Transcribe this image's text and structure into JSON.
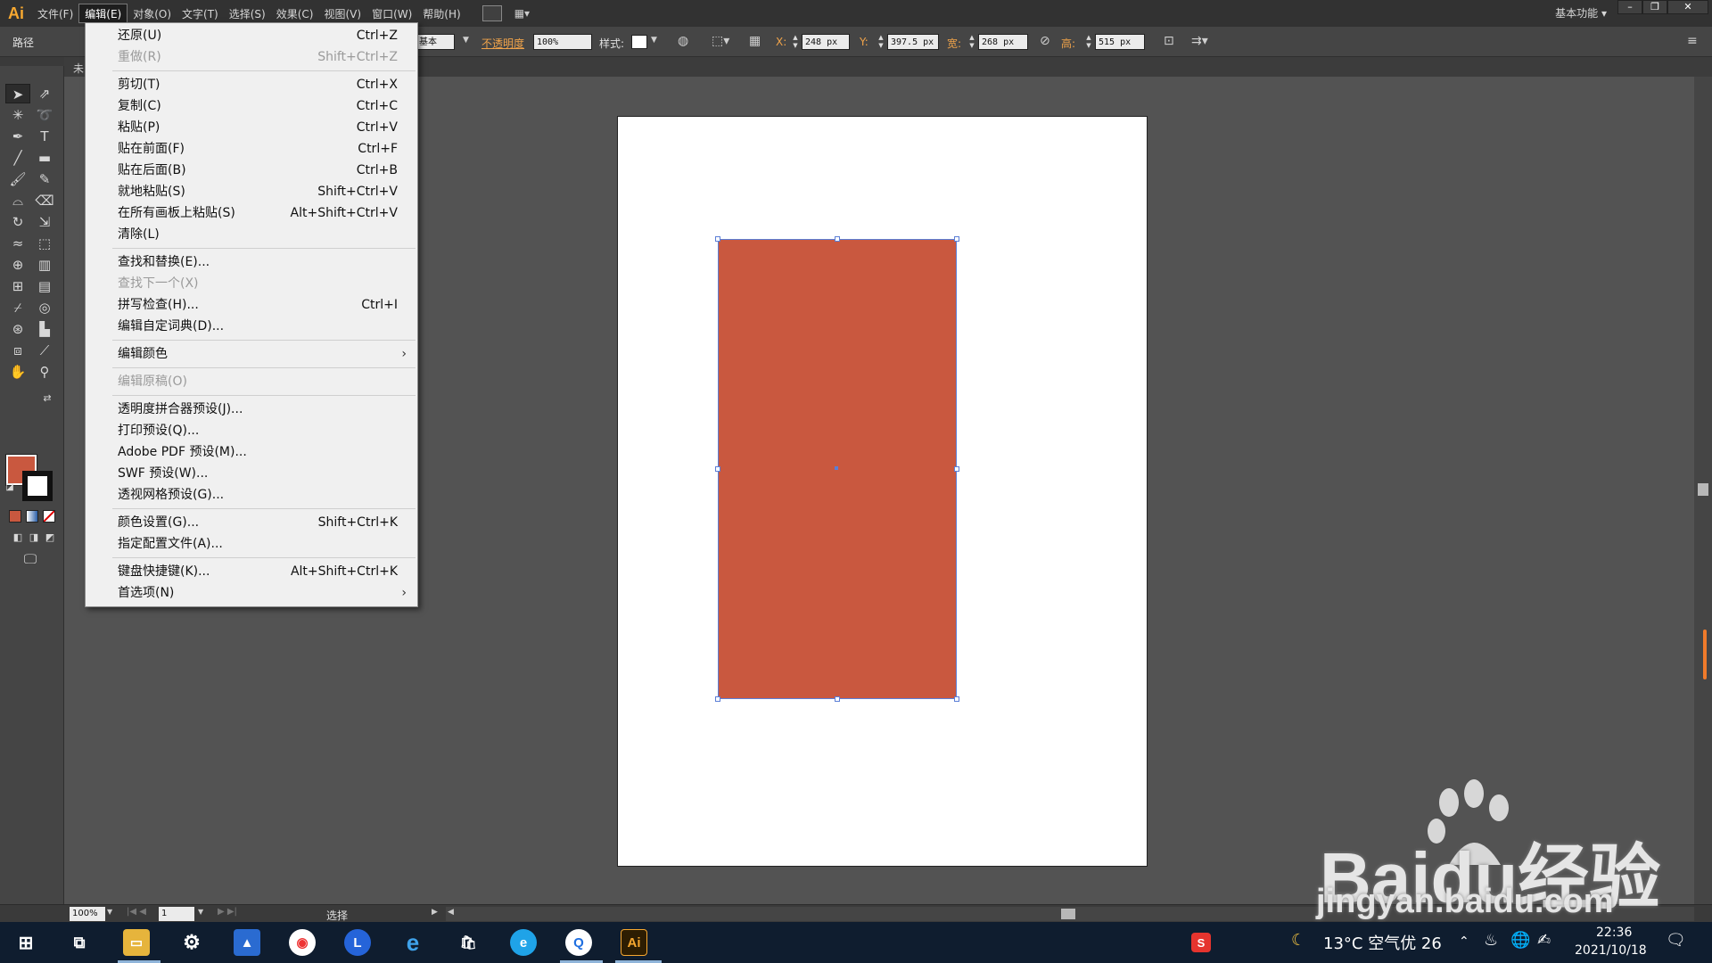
{
  "app": {
    "logo": "Ai",
    "menus": [
      "文件(F)",
      "编辑(E)",
      "对象(O)",
      "文字(T)",
      "选择(S)",
      "效果(C)",
      "视图(V)",
      "窗口(W)",
      "帮助(H)"
    ],
    "workspace": "基本功能",
    "workspace_arrow": "▾"
  },
  "control_bar": {
    "path_label": "路径",
    "stroke_profile": "基本",
    "opacity_label": "不透明度",
    "opacity_value": "100%",
    "style_label": "样式:",
    "x_label": "X:",
    "x_value": "248 px",
    "y_label": "Y:",
    "y_value": "397.5 px",
    "w_label": "宽:",
    "w_value": "268 px",
    "h_label": "高:",
    "h_value": "515 px"
  },
  "doc_tab": {
    "label": "未"
  },
  "swatches": {
    "fill": "#c9583f",
    "stroke": "#ffffff"
  },
  "edit_menu": [
    {
      "label": "还原(U)",
      "shortcut": "Ctrl+Z",
      "disabled": false
    },
    {
      "label": "重做(R)",
      "shortcut": "Shift+Ctrl+Z",
      "disabled": true
    },
    {
      "sep": true
    },
    {
      "label": "剪切(T)",
      "shortcut": "Ctrl+X",
      "disabled": false
    },
    {
      "label": "复制(C)",
      "shortcut": "Ctrl+C",
      "disabled": false
    },
    {
      "label": "粘贴(P)",
      "shortcut": "Ctrl+V",
      "disabled": false
    },
    {
      "label": "贴在前面(F)",
      "shortcut": "Ctrl+F",
      "disabled": false
    },
    {
      "label": "贴在后面(B)",
      "shortcut": "Ctrl+B",
      "disabled": false
    },
    {
      "label": "就地粘贴(S)",
      "shortcut": "Shift+Ctrl+V",
      "disabled": false
    },
    {
      "label": "在所有画板上粘贴(S)",
      "shortcut": "Alt+Shift+Ctrl+V",
      "disabled": false
    },
    {
      "label": "清除(L)",
      "shortcut": "",
      "disabled": false
    },
    {
      "sep": true
    },
    {
      "label": "查找和替换(E)...",
      "shortcut": "",
      "disabled": false
    },
    {
      "label": "查找下一个(X)",
      "shortcut": "",
      "disabled": true
    },
    {
      "label": "拼写检查(H)...",
      "shortcut": "Ctrl+I",
      "disabled": false
    },
    {
      "label": "编辑自定词典(D)...",
      "shortcut": "",
      "disabled": false
    },
    {
      "sep": true
    },
    {
      "label": "编辑颜色",
      "shortcut": "",
      "disabled": false,
      "submenu": true
    },
    {
      "sep": true
    },
    {
      "label": "编辑原稿(O)",
      "shortcut": "",
      "disabled": true
    },
    {
      "sep": true
    },
    {
      "label": "透明度拼合器预设(J)...",
      "shortcut": "",
      "disabled": false
    },
    {
      "label": "打印预设(Q)...",
      "shortcut": "",
      "disabled": false
    },
    {
      "label": "Adobe PDF 预设(M)...",
      "shortcut": "",
      "disabled": false
    },
    {
      "label": "SWF 预设(W)...",
      "shortcut": "",
      "disabled": false
    },
    {
      "label": "透视网格预设(G)...",
      "shortcut": "",
      "disabled": false
    },
    {
      "sep": true
    },
    {
      "label": "颜色设置(G)...",
      "shortcut": "Shift+Ctrl+K",
      "disabled": false
    },
    {
      "label": "指定配置文件(A)...",
      "shortcut": "",
      "disabled": false
    },
    {
      "sep": true
    },
    {
      "label": "键盘快捷键(K)...",
      "shortcut": "Alt+Shift+Ctrl+K",
      "disabled": false
    },
    {
      "label": "首选项(N)",
      "shortcut": "",
      "disabled": false,
      "submenu": true
    }
  ],
  "status_bar": {
    "zoom": "100%",
    "page": "1",
    "mode": "选择"
  },
  "taskbar": {
    "weather": "13°C 空气优 26",
    "time": "22:36",
    "date": "2021/10/18"
  },
  "watermark": {
    "brand": "Bai",
    "brand_rest": "du经验",
    "site": "jingyan.baidu.com"
  }
}
